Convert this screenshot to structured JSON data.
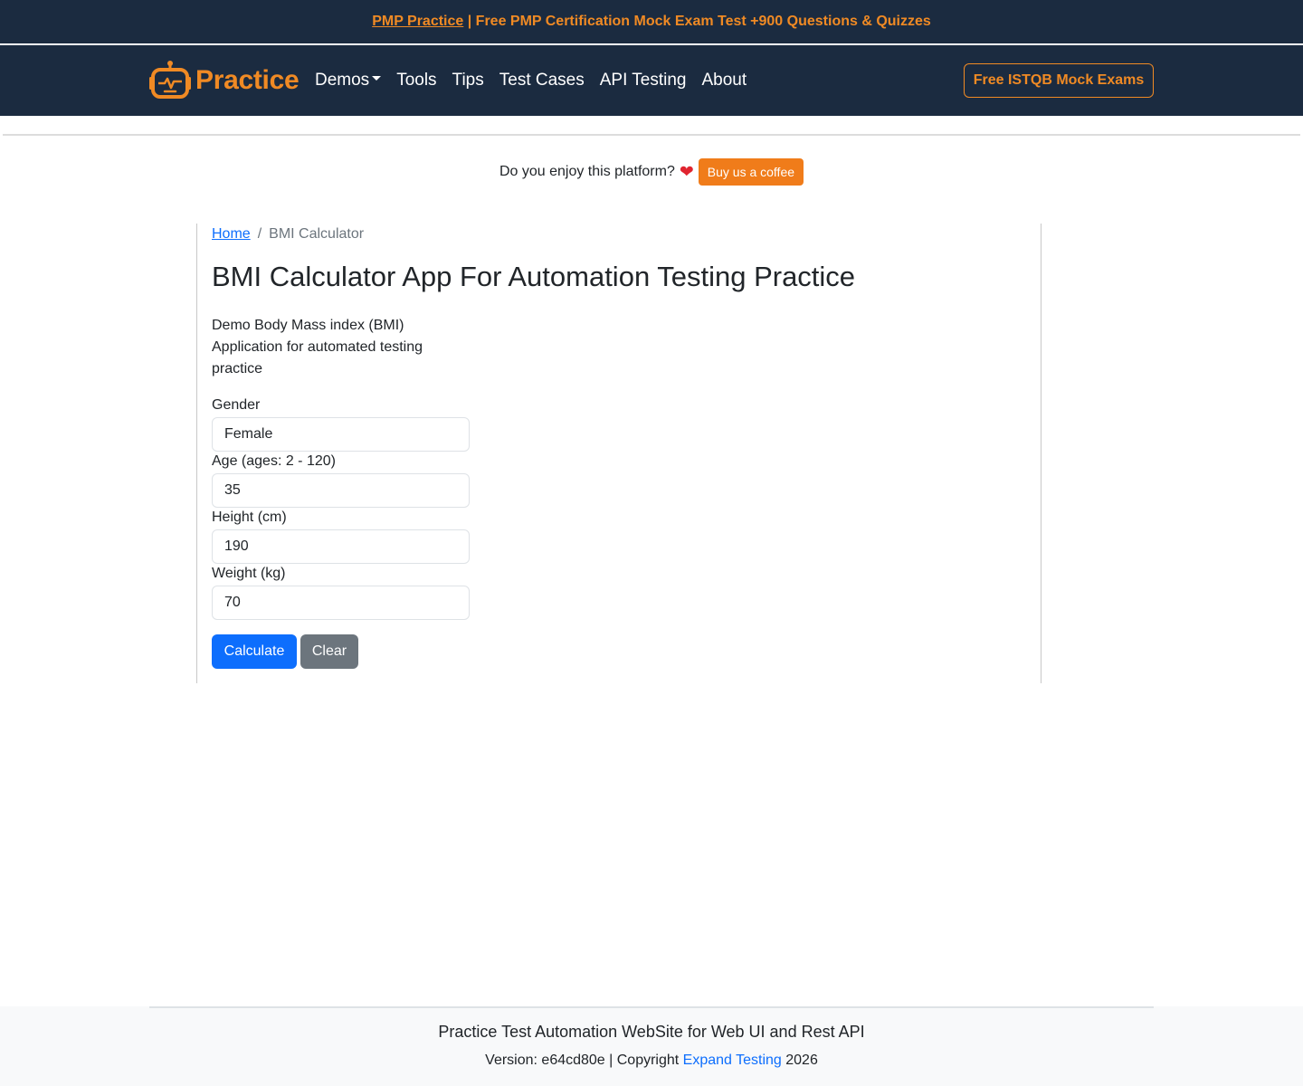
{
  "promo": {
    "link_text": "PMP Practice",
    "text": " | Free PMP Certification Mock Exam Test +900 Questions & Quizzes"
  },
  "nav": {
    "brand": "Practice",
    "links": [
      "Demos",
      "Tools",
      "Tips",
      "Test Cases",
      "API Testing",
      "About"
    ],
    "cta": "Free ISTQB Mock Exams"
  },
  "coffee": {
    "question": "Do you enjoy this platform?",
    "button": "Buy us a coffee"
  },
  "breadcrumb": {
    "home": "Home",
    "separator": "/",
    "current": "BMI Calculator"
  },
  "page": {
    "title": "BMI Calculator App For Automation Testing Practice",
    "description": "Demo Body Mass index (BMI) Application for automated testing practice"
  },
  "form": {
    "gender": {
      "label": "Gender",
      "value": "Female"
    },
    "age": {
      "label": "Age (ages: 2 - 120)",
      "value": "35"
    },
    "height": {
      "label": "Height (cm)",
      "value": "190"
    },
    "weight": {
      "label": "Weight (kg)",
      "value": "70"
    },
    "calculate": "Calculate",
    "clear": "Clear"
  },
  "footer": {
    "title": "Practice Test Automation WebSite for Web UI and Rest API",
    "version_prefix": "Version: e64cd80e | Copyright ",
    "company": "Expand Testing",
    "year": " 2026"
  },
  "colors": {
    "navy": "#1b2b40",
    "orange": "#f08a24",
    "primary": "#0d6efd",
    "secondary": "#6c757d"
  },
  "icons": {
    "brand": "robot-icon",
    "heart": "heart-icon",
    "dropdown": "caret-down-icon"
  }
}
